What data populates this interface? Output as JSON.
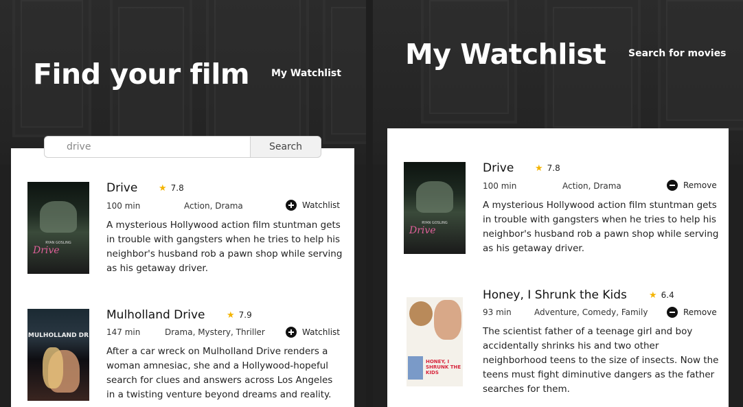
{
  "search_view": {
    "hero_title": "Find your film",
    "nav_link": "My Watchlist",
    "search": {
      "value": "drive",
      "button": "Search"
    },
    "movies": [
      {
        "title": "Drive",
        "rating": "7.8",
        "runtime": "100 min",
        "genres": "Action, Drama",
        "action": "Watchlist",
        "action_icon": "plus-circle-icon",
        "description": "A mysterious Hollywood action film stuntman gets in trouble with gangsters when he tries to help his neighbor's husband rob a pawn shop while serving as his getaway driver.",
        "poster": {
          "actor": "RYAN GOSLING",
          "title": "Drive"
        }
      },
      {
        "title": "Mulholland Drive",
        "rating": "7.9",
        "runtime": "147 min",
        "genres": "Drama, Mystery, Thriller",
        "action": "Watchlist",
        "action_icon": "plus-circle-icon",
        "description": "After a car wreck on Mulholland Drive renders a woman amnesiac, she and a Hollywood-hopeful search for clues and answers across Los Angeles in a twisting venture beyond dreams and reality.",
        "poster": {
          "title": "MULHOLLAND DR"
        }
      }
    ]
  },
  "watchlist_view": {
    "hero_title": "My Watchlist",
    "nav_link": "Search for movies",
    "movies": [
      {
        "title": "Drive",
        "rating": "7.8",
        "runtime": "100 min",
        "genres": "Action, Drama",
        "action": "Remove",
        "action_icon": "minus-circle-icon",
        "description": "A mysterious Hollywood action film stuntman gets in trouble with gangsters when he tries to help his neighbor's husband rob a pawn shop while serving as his getaway driver.",
        "poster": {
          "actor": "RYAN GOSLING",
          "title": "Drive"
        }
      },
      {
        "title": "Honey, I Shrunk the Kids",
        "rating": "6.4",
        "runtime": "93 min",
        "genres": "Adventure, Comedy, Family",
        "action": "Remove",
        "action_icon": "minus-circle-icon",
        "description": "The scientist father of a teenage girl and boy accidentally shrinks his and two other neighborhood teens to the size of insects. Now the teens must fight diminutive dangers as the father searches for them.",
        "poster": {
          "title": "HONEY, I SHRUNK THE KIDS"
        }
      }
    ]
  },
  "colors": {
    "star": "#f4b400",
    "panel": "#ffffff",
    "hero_bg": "#262626",
    "drive_accent": "#e0609a"
  }
}
